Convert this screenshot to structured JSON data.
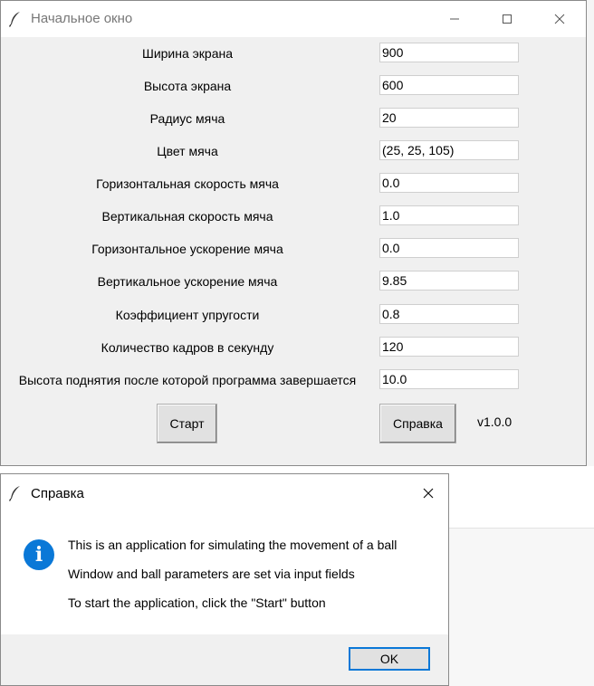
{
  "main_window": {
    "title": "Начальное окно",
    "fields": [
      {
        "label": "Ширина экрана",
        "value": "900"
      },
      {
        "label": "Высота экрана",
        "value": "600"
      },
      {
        "label": "Радиус мяча",
        "value": "20"
      },
      {
        "label": "Цвет мяча",
        "value": "(25, 25, 105)"
      },
      {
        "label": "Горизонтальная скорость мяча",
        "value": "0.0"
      },
      {
        "label": "Вертикальная скорость мяча",
        "value": "1.0"
      },
      {
        "label": "Горизонтальное ускорение мяча",
        "value": "0.0"
      },
      {
        "label": "Вертикальное ускорение мяча",
        "value": "9.85"
      },
      {
        "label": "Коэффициент упругости",
        "value": "0.8"
      },
      {
        "label": "Количество кадров в секунду",
        "value": "120"
      },
      {
        "label": "Высота поднятия после которой программа завершается",
        "value": "10.0"
      }
    ],
    "start_button": "Старт",
    "help_button": "Справка",
    "version": "v1.0.0"
  },
  "dialog": {
    "title": "Справка",
    "info_icon_glyph": "i",
    "messages": [
      "This is an application for simulating the movement of a ball",
      "Window and ball parameters are set via input fields",
      "To start the application, click the \"Start\" button"
    ],
    "ok_button": "OK"
  },
  "colors": {
    "accent": "#0a78d7",
    "window_bg": "#f0f0f0"
  },
  "icons": [
    "feather-icon",
    "minimize-icon",
    "maximize-icon",
    "close-icon",
    "info-icon"
  ]
}
